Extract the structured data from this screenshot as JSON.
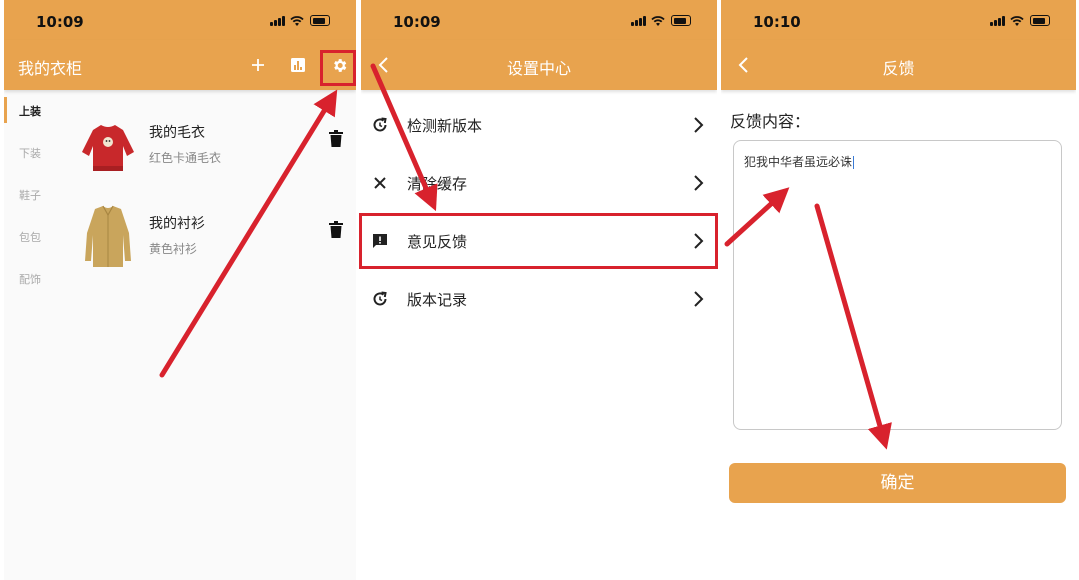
{
  "screens": [
    {
      "status_time": "10:09",
      "nav_title": "我的衣柜",
      "categories": [
        "上装",
        "下装",
        "鞋子",
        "包包",
        "配饰"
      ],
      "items": [
        {
          "name": "我的毛衣",
          "desc": "红色卡通毛衣"
        },
        {
          "name": "我的衬衫",
          "desc": "黄色衬衫"
        }
      ],
      "icons": [
        "plus-icon",
        "chart-icon",
        "gear-icon",
        "trash-icon"
      ]
    },
    {
      "status_time": "10:09",
      "nav_title": "设置中心",
      "menu": [
        {
          "label": "检测新版本",
          "icon": "refresh-icon"
        },
        {
          "label": "清除缓存",
          "icon": "close-icon"
        },
        {
          "label": "意见反馈",
          "icon": "feedback-icon"
        },
        {
          "label": "版本记录",
          "icon": "history-icon"
        }
      ]
    },
    {
      "status_time": "10:10",
      "nav_title": "反馈",
      "feedback_label": "反馈内容：",
      "feedback_text": "犯我中华者虽远必诛",
      "submit_label": "确定"
    }
  ],
  "theme": {
    "accent": "#e8a34e",
    "highlight": "#d8222d"
  }
}
